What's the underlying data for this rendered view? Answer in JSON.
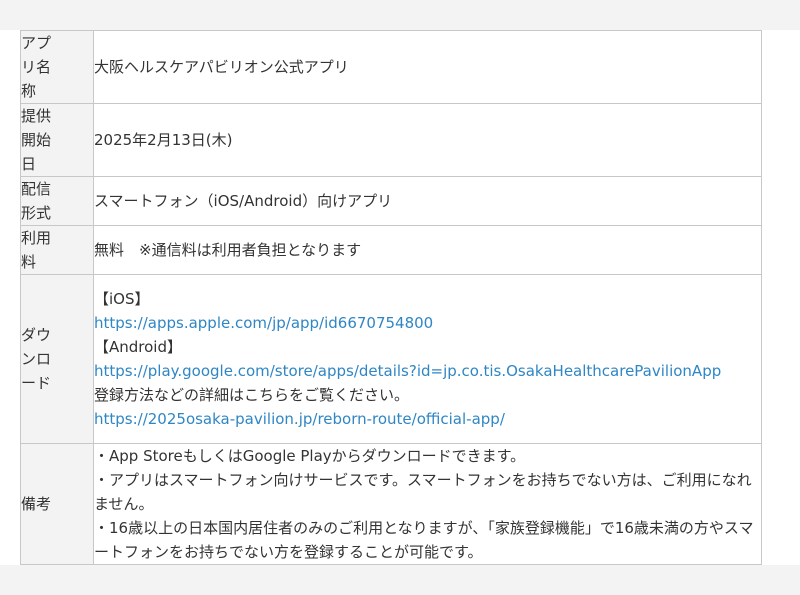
{
  "rows": {
    "app_name": {
      "label": "アプリ名称",
      "value": "大阪ヘルスケアパビリオン公式アプリ"
    },
    "release_date": {
      "label": "提供開始日",
      "value": "2025年2月13日(木)"
    },
    "distribution": {
      "label": "配信形式",
      "value": "スマートフォン（iOS/Android）向けアプリ"
    },
    "fee": {
      "label": "利用料",
      "value": "無料　※通信料は利用者負担となります"
    },
    "download": {
      "label": "ダウンロード",
      "ios_heading": "【iOS】",
      "ios_link": "https://apps.apple.com/jp/app/id6670754800",
      "android_heading": "【Android】",
      "android_link": "https://play.google.com/store/apps/details?id=jp.co.tis.OsakaHealthcarePavilionApp",
      "registration_note": "登録方法などの詳細はこちらをご覧ください。",
      "registration_link": "https://2025osaka-pavilion.jp/reborn-route/official-app/"
    },
    "remarks": {
      "label": "備考",
      "note1": "・App StoreもしくはGoogle Playからダウンロードできます。",
      "note2": "・アプリはスマートフォン向けサービスです。スマートフォンをお持ちでない方は、ご利用になれません。",
      "note3": "・16歳以上の日本国内居住者のみのご利用となりますが、「家族登録機能」で16歳未満の方やスマートフォンをお持ちでない方を登録することが可能です。"
    }
  },
  "colors": {
    "link": "#2f86c5",
    "border": "#c8c8c8",
    "label_bg": "#f3f3f3",
    "text": "#333333"
  }
}
